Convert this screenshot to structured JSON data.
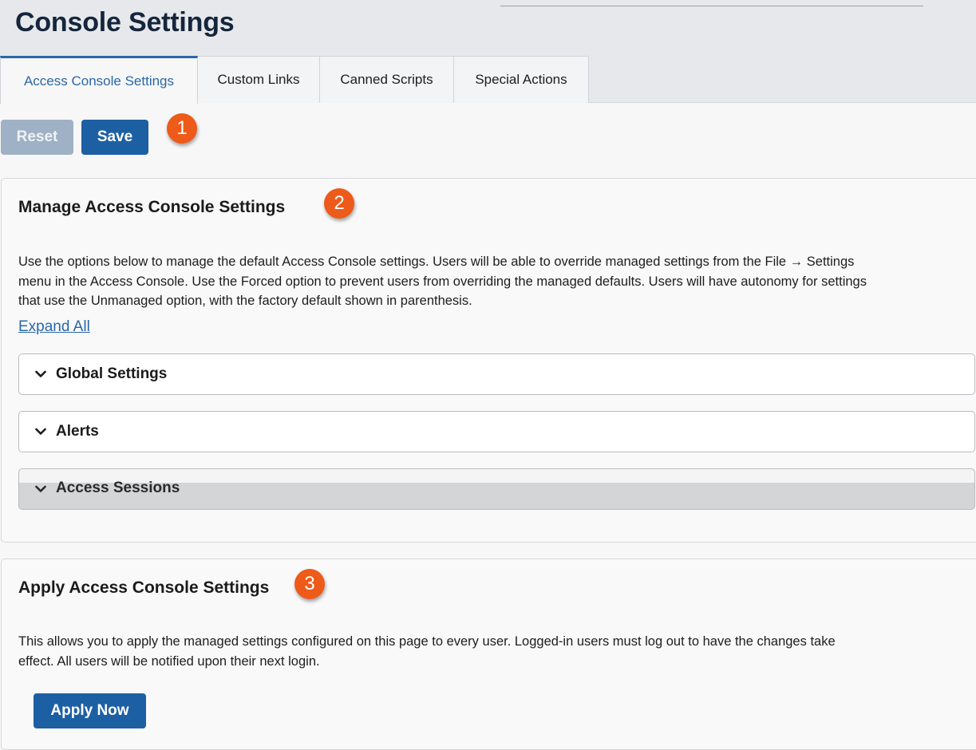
{
  "header": {
    "title": "Console Settings"
  },
  "tabs": [
    {
      "label": "Access Console Settings",
      "active": true
    },
    {
      "label": "Custom Links",
      "active": false
    },
    {
      "label": "Canned Scripts",
      "active": false
    },
    {
      "label": "Special Actions",
      "active": false
    }
  ],
  "toolbar": {
    "reset_label": "Reset",
    "save_label": "Save"
  },
  "badges": [
    "1",
    "2",
    "3"
  ],
  "manage": {
    "title": "Manage Access Console Settings",
    "description_lines": [
      "Use the options below to manage the default Access Console settings. Users will be able to override managed settings from the File → Settings",
      "menu in the Access Console. Use the Forced option to prevent users from overriding the managed defaults. Users will have autonomy for settings",
      "that use the Unmanaged option, with the factory default shown in parenthesis."
    ],
    "expand_all_label": "Expand All",
    "sections": [
      {
        "label": "Global Settings",
        "icon": "chevron-down-icon"
      },
      {
        "label": "Alerts",
        "icon": "chevron-down-icon"
      },
      {
        "label": "Access Sessions",
        "icon": "chevron-down-icon"
      }
    ]
  },
  "apply": {
    "title": "Apply Access Console Settings",
    "description_lines": [
      "This allows you to apply the managed settings configured on this page to every user. Logged-in users must log out to have the changes take",
      "effect. All users will be notified upon their next login."
    ],
    "apply_label": "Apply Now"
  },
  "colors": {
    "accent": "#1d5fa3",
    "link": "#2a67a8",
    "badge": "#ee5a19",
    "disabled_button": "#9fb1c4"
  }
}
